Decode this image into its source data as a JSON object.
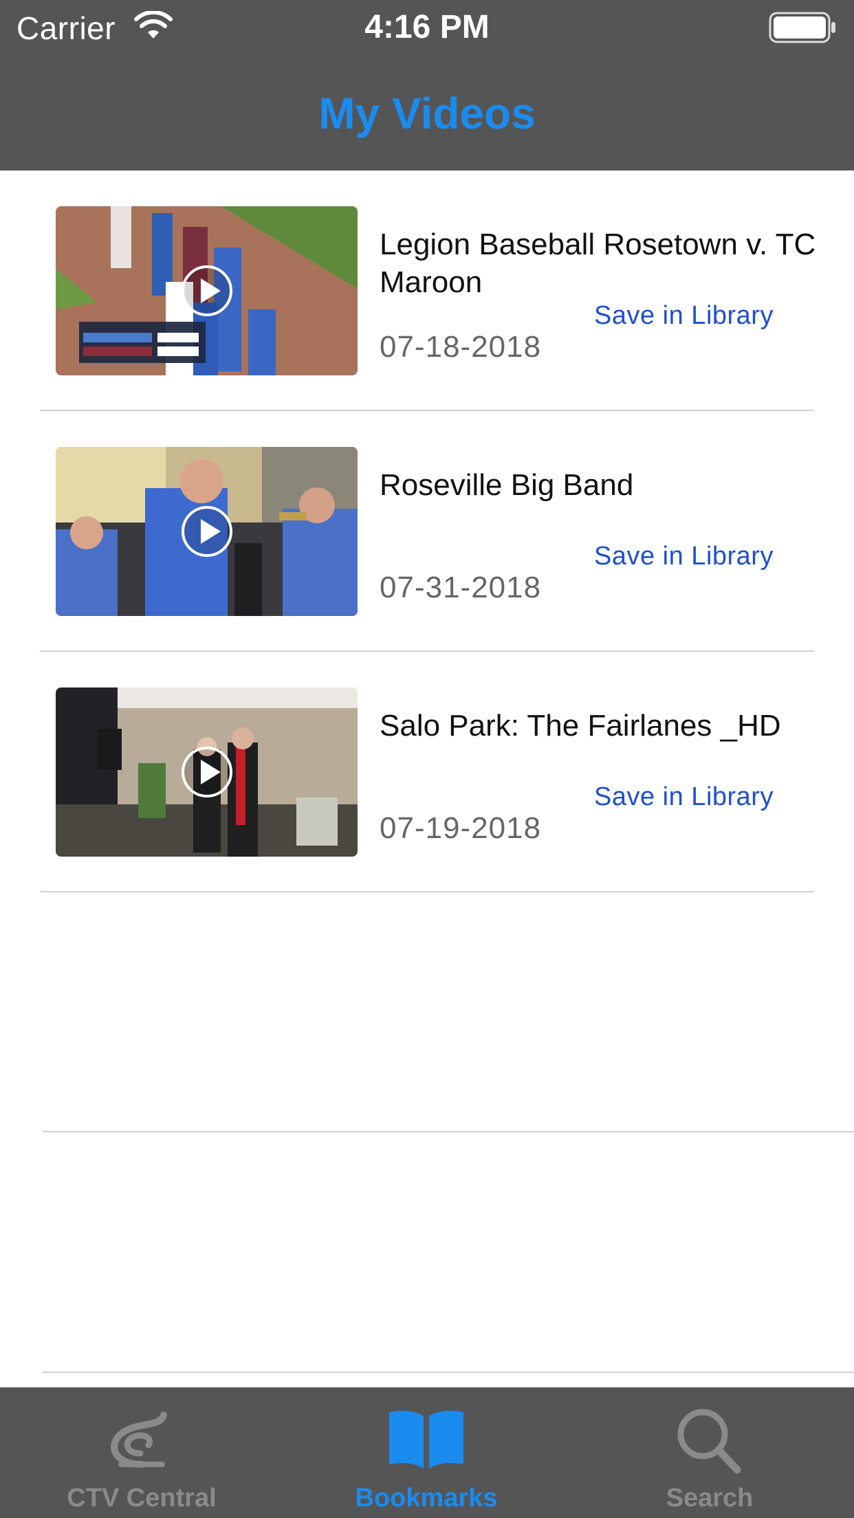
{
  "status_bar": {
    "carrier": "Carrier",
    "time": "4:16 PM"
  },
  "nav": {
    "title": "My Videos"
  },
  "videos": [
    {
      "title": "Legion Baseball Rosetown v. TC Maroon",
      "date": "07-18-2018",
      "save_label": "Save in Library",
      "thumbnail": "baseball-thumbnail"
    },
    {
      "title": "Roseville Big Band",
      "date": "07-31-2018",
      "save_label": "Save in Library",
      "thumbnail": "band-thumbnail"
    },
    {
      "title": "Salo Park: The Fairlanes _HD",
      "date": "07-19-2018",
      "save_label": "Save in Library",
      "thumbnail": "fairlanes-thumbnail"
    }
  ],
  "tabs": [
    {
      "label": "CTV Central",
      "icon": "ctv-logo-icon",
      "active": false
    },
    {
      "label": "Bookmarks",
      "icon": "book-icon",
      "active": true
    },
    {
      "label": "Search",
      "icon": "search-icon",
      "active": false
    }
  ],
  "colors": {
    "accent": "#1a8cf0",
    "link": "#1f4fd1",
    "bar_background": "#555555",
    "inactive_tab": "#8a8a8a"
  }
}
